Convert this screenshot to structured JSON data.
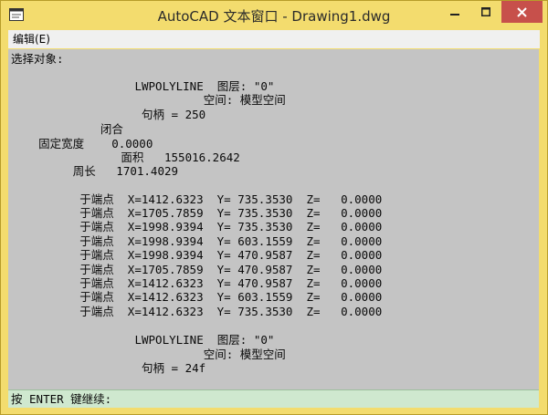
{
  "window": {
    "title": "AutoCAD 文本窗口 - Drawing1.dwg",
    "frame_color": "#f3dc6e",
    "close_color": "#c7504b"
  },
  "menu": {
    "items": [
      {
        "label": "编辑(E)"
      }
    ]
  },
  "text_window": {
    "background": "#c4c4c4",
    "lines": [
      "选择对象:",
      "",
      "                  LWPOLYLINE  图层: \"0\"",
      "                            空间: 模型空间",
      "                   句柄 = 250",
      "             闭合",
      "    固定宽度    0.0000",
      "                面积   155016.2642",
      "         周长   1701.4029",
      "",
      "          于端点  X=1412.6323  Y= 735.3530  Z=   0.0000",
      "          于端点  X=1705.7859  Y= 735.3530  Z=   0.0000",
      "          于端点  X=1998.9394  Y= 735.3530  Z=   0.0000",
      "          于端点  X=1998.9394  Y= 603.1559  Z=   0.0000",
      "          于端点  X=1998.9394  Y= 470.9587  Z=   0.0000",
      "          于端点  X=1705.7859  Y= 470.9587  Z=   0.0000",
      "          于端点  X=1412.6323  Y= 470.9587  Z=   0.0000",
      "          于端点  X=1412.6323  Y= 603.1559  Z=   0.0000",
      "          于端点  X=1412.6323  Y= 735.3530  Z=   0.0000",
      "",
      "                  LWPOLYLINE  图层: \"0\"",
      "                            空间: 模型空间",
      "                   句柄 = 24f"
    ]
  },
  "command": {
    "prompt": "按 ENTER 键继续:",
    "background": "#cfe8cf"
  }
}
